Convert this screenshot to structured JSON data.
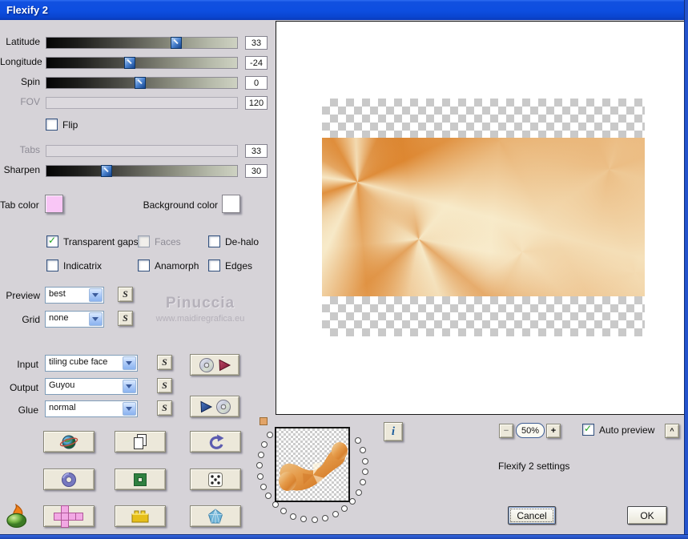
{
  "window": {
    "title": "Flexify 2"
  },
  "sliders": [
    {
      "label": "Latitude",
      "value": "33",
      "fraction": 0.69,
      "enabled": true
    },
    {
      "label": "Longitude",
      "value": "-24",
      "fraction": 0.43,
      "enabled": true
    },
    {
      "label": "Spin",
      "value": "0",
      "fraction": 0.49,
      "enabled": true
    },
    {
      "label": "FOV",
      "value": "120",
      "fraction": null,
      "enabled": false
    },
    {
      "label": "Tabs",
      "value": "33",
      "fraction": null,
      "enabled": false
    },
    {
      "label": "Sharpen",
      "value": "30",
      "fraction": 0.3,
      "enabled": true
    }
  ],
  "flip": {
    "label": "Flip",
    "checked": false
  },
  "tab_color": {
    "label": "Tab color",
    "color": "#f9c6f6"
  },
  "background_color": {
    "label": "Background color",
    "color": "#ffffff"
  },
  "options": [
    {
      "label": "Transparent gaps",
      "checked": true,
      "enabled": true
    },
    {
      "label": "Faces",
      "checked": false,
      "enabled": false
    },
    {
      "label": "De-halo",
      "checked": false,
      "enabled": true
    },
    {
      "label": "Indicatrix",
      "checked": false,
      "enabled": true
    },
    {
      "label": "Anamorph",
      "checked": false,
      "enabled": true
    },
    {
      "label": "Edges",
      "checked": false,
      "enabled": true
    }
  ],
  "selects": {
    "preview": {
      "label": "Preview",
      "value": "best"
    },
    "grid": {
      "label": "Grid",
      "value": "none"
    },
    "input": {
      "label": "Input",
      "value": "tiling cube face"
    },
    "output": {
      "label": "Output",
      "value": "Guyou"
    },
    "glue": {
      "label": "Glue",
      "value": "normal"
    }
  },
  "s_button": "S",
  "watermark": {
    "line1": "Pinuccia",
    "line2": "www.maidiregrafica.eu"
  },
  "zoom": {
    "minus": "−",
    "level": "50%",
    "plus": "+"
  },
  "auto_preview": {
    "label": "Auto preview",
    "checked": true
  },
  "status_text": "Flexify 2 settings",
  "info_button": "i",
  "collapse_button": "^",
  "actions": {
    "cancel": "Cancel",
    "ok": "OK"
  },
  "icons": {
    "check": "✓"
  }
}
